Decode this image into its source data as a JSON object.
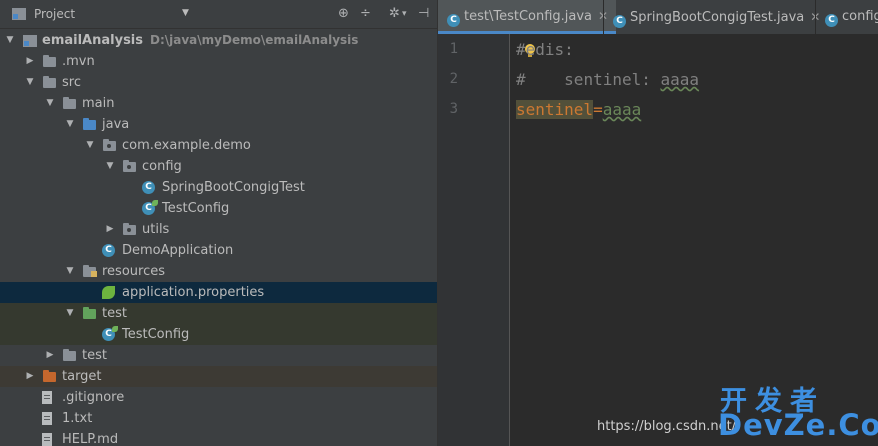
{
  "project_panel": {
    "title": "Project",
    "header_icons": [
      "globe-icon",
      "collapse-icon",
      "gear-icon",
      "hide-icon"
    ]
  },
  "tree": [
    {
      "label": "emailAnalysis",
      "path": "D:\\java\\myDemo\\emailAnalysis",
      "icon": "module-icon",
      "expanded": true,
      "bold": true
    },
    {
      "label": ".mvn",
      "icon": "folder-icon",
      "expanded": false
    },
    {
      "label": "src",
      "icon": "folder-icon",
      "expanded": true
    },
    {
      "label": "main",
      "icon": "folder-icon",
      "expanded": true
    },
    {
      "label": "java",
      "icon": "source-folder-icon",
      "expanded": true
    },
    {
      "label": "com.example.demo",
      "icon": "package-icon",
      "expanded": true
    },
    {
      "label": "config",
      "icon": "package-icon",
      "expanded": true
    },
    {
      "label": "SpringBootCongigTest",
      "icon": "class-icon",
      "expanded": null
    },
    {
      "label": "TestConfig",
      "icon": "class-icon",
      "expanded": null
    },
    {
      "label": "utils",
      "icon": "package-icon",
      "expanded": false
    },
    {
      "label": "DemoApplication",
      "icon": "spring-class-icon",
      "expanded": null
    },
    {
      "label": "resources",
      "icon": "resources-folder-icon",
      "expanded": true
    },
    {
      "label": "application.properties",
      "icon": "spring-properties-icon",
      "expanded": null,
      "selected": true
    },
    {
      "label": "test",
      "icon": "test-folder-icon",
      "expanded": true
    },
    {
      "label": "TestConfig",
      "icon": "class-icon",
      "expanded": null
    },
    {
      "label": "test",
      "icon": "folder-icon",
      "expanded": false
    },
    {
      "label": "target",
      "icon": "excluded-folder-icon",
      "expanded": false
    },
    {
      "label": ".gitignore",
      "icon": "file-icon",
      "expanded": null
    },
    {
      "label": "1.txt",
      "icon": "file-icon",
      "expanded": null
    },
    {
      "label": "HELP.md",
      "icon": "file-icon",
      "expanded": null
    }
  ],
  "tabs": [
    {
      "label": "test\\TestConfig.java",
      "active": true,
      "closable": true
    },
    {
      "label": "SpringBootCongigTest.java",
      "active": false,
      "closable": true
    },
    {
      "label": "config\\",
      "active": false,
      "closable": false
    }
  ],
  "editor": {
    "lines": [
      {
        "num": "1",
        "prefix": "#",
        "text": "edis:"
      },
      {
        "num": "2",
        "prefix": "#",
        "text": "    sentinel: aaaa"
      },
      {
        "num": "3",
        "key": "sentinel",
        "eq": "=",
        "value": "aaaa"
      }
    ]
  },
  "watermark": {
    "url": "https://blog.csdn.net/",
    "cn": "开发者",
    "en": "DevZe.CoM"
  },
  "colors": {
    "panel_bg": "#3c3f41",
    "editor_bg": "#2b2b2b",
    "selection": "#0d293e",
    "accent": "#4a88c7",
    "comment": "#808080",
    "property_key": "#cc7832",
    "property_value": "#6a8759"
  }
}
